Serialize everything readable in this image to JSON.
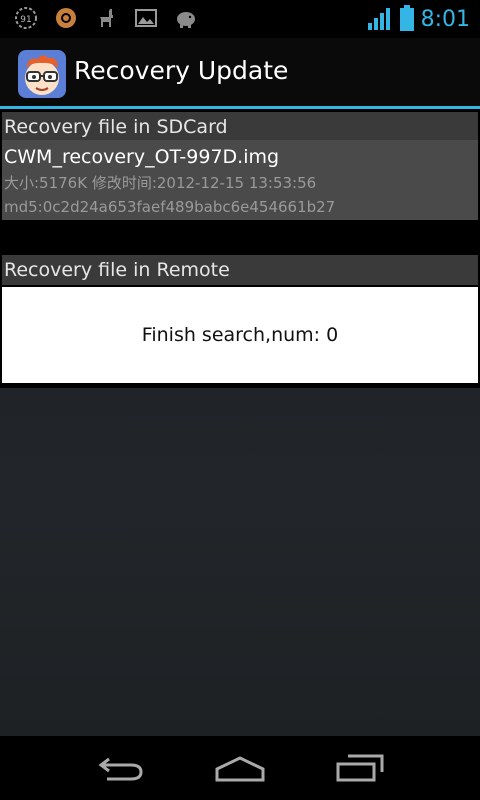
{
  "status_bar": {
    "clock": "8:01",
    "notification_icons": [
      "91-icon",
      "circle-app-icon",
      "llama-icon",
      "image-icon",
      "piggy-bank-icon"
    ],
    "signal_icon": "signal-icon",
    "battery_icon": "battery-icon",
    "accent_color": "#33b5e5"
  },
  "action_bar": {
    "title": "Recovery Update",
    "app_icon": "glasses-face-icon"
  },
  "sdcard_section": {
    "header": "Recovery file in SDCard",
    "items": [
      {
        "name": "CWM_recovery_OT-997D.img",
        "meta": "大小:5176K 修改时间:2012-12-15 13:53:56",
        "md5": "md5:0c2d24a653faef489babc6e454661b27"
      }
    ]
  },
  "remote_section": {
    "header": "Recovery file in Remote",
    "status": "Finish search,num: 0"
  },
  "nav_bar": {
    "back": "back-icon",
    "home": "home-icon",
    "recents": "recents-icon"
  }
}
